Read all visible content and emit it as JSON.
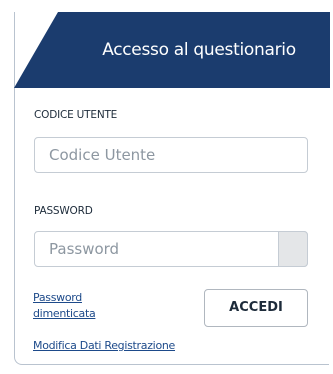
{
  "header": {
    "title": "Accesso al questionario",
    "bg_color": "#1b3c6e"
  },
  "form": {
    "user_label": "CODICE UTENTE",
    "user_placeholder": "Codice Utente",
    "password_label": "PASSWORD",
    "password_placeholder": "Password"
  },
  "links": {
    "forgot_password_line1": "Password",
    "forgot_password_line2": "dimenticata",
    "edit_registration": "Modifica Dati Registrazione"
  },
  "actions": {
    "login_label": "ACCEDI"
  },
  "colors": {
    "accent": "#1b3c6e",
    "link": "#1d4a8a",
    "border": "#c5ccd4"
  }
}
